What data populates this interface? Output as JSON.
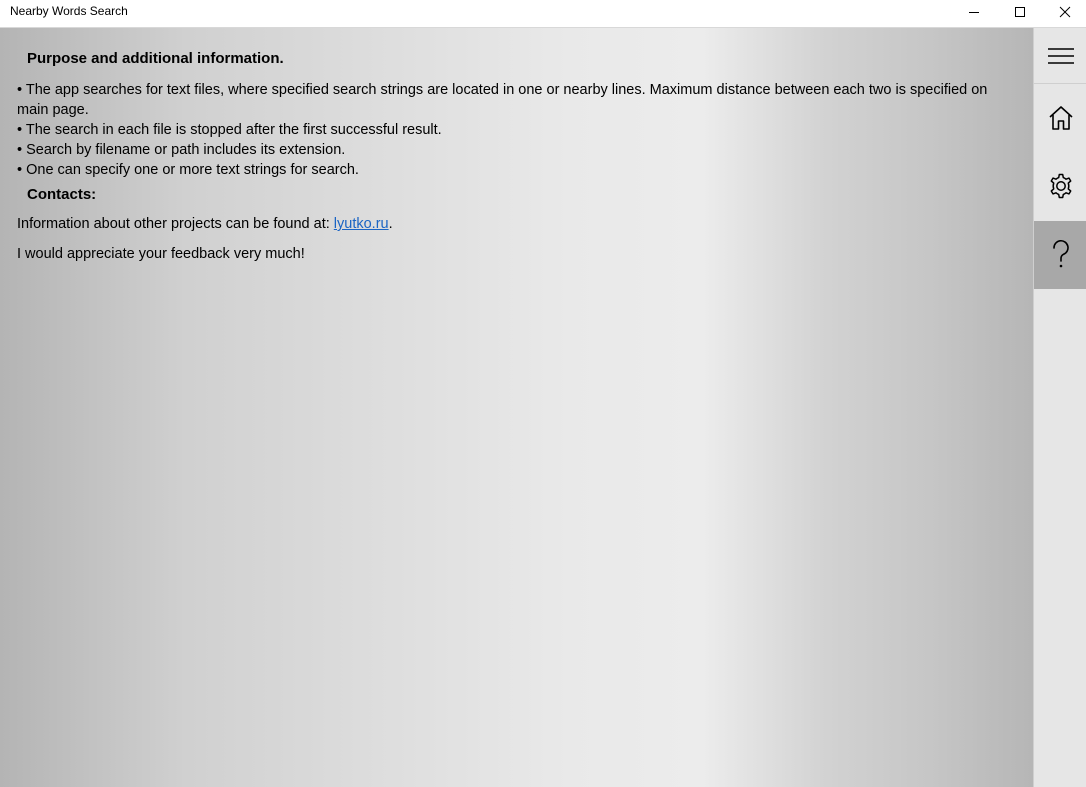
{
  "window": {
    "title": "Nearby Words Search",
    "controls": [
      "minimize-icon",
      "maximize-icon",
      "close-icon"
    ]
  },
  "content": {
    "purpose_heading": "Purpose and additional information.",
    "bullets": [
      "• The app searches for text files, where specified search strings are located in one or nearby lines. Maximum distance between each two is specified on main page.",
      "• The search in each file is stopped after the first successful result.",
      "• Search by filename or path includes its extension.",
      "• One can specify one or more text strings for search."
    ],
    "contacts_heading": "Contacts:",
    "info_prefix": "Information about other projects can be found at: ",
    "info_link": "lyutko.ru",
    "info_suffix": ".",
    "feedback": "I would appreciate your feedback very much!"
  },
  "sidebar": {
    "items": [
      {
        "name": "menu",
        "icon": "hamburger-icon"
      },
      {
        "name": "home",
        "icon": "home-icon"
      },
      {
        "name": "settings",
        "icon": "gear-icon"
      },
      {
        "name": "help",
        "icon": "question-icon",
        "selected": true
      }
    ]
  },
  "colors": {
    "link": "#1a64c4",
    "selected_nav": "#a8a8a8",
    "sidebar_bg": "#e6e6e6"
  }
}
